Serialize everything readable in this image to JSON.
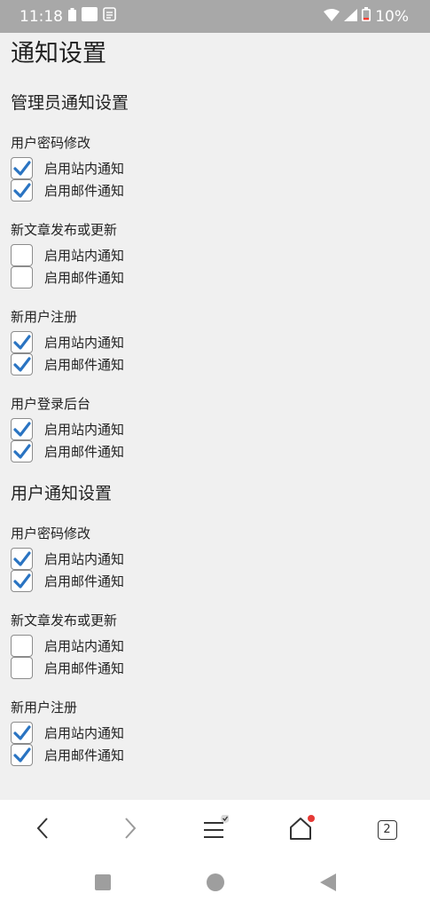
{
  "status_bar": {
    "time": "11:18",
    "battery": "10%"
  },
  "page_title": "通知设置",
  "sections": [
    {
      "title": "管理员通知设置",
      "groups": [
        {
          "label": "用户密码修改",
          "options": [
            {
              "label": "启用站内通知",
              "checked": true
            },
            {
              "label": "启用邮件通知",
              "checked": true
            }
          ]
        },
        {
          "label": "新文章发布或更新",
          "options": [
            {
              "label": "启用站内通知",
              "checked": false
            },
            {
              "label": "启用邮件通知",
              "checked": false
            }
          ]
        },
        {
          "label": "新用户注册",
          "options": [
            {
              "label": "启用站内通知",
              "checked": true
            },
            {
              "label": "启用邮件通知",
              "checked": true
            }
          ]
        },
        {
          "label": "用户登录后台",
          "options": [
            {
              "label": "启用站内通知",
              "checked": true
            },
            {
              "label": "启用邮件通知",
              "checked": true
            }
          ]
        }
      ]
    },
    {
      "title": "用户通知设置",
      "groups": [
        {
          "label": "用户密码修改",
          "options": [
            {
              "label": "启用站内通知",
              "checked": true
            },
            {
              "label": "启用邮件通知",
              "checked": true
            }
          ]
        },
        {
          "label": "新文章发布或更新",
          "options": [
            {
              "label": "启用站内通知",
              "checked": false
            },
            {
              "label": "启用邮件通知",
              "checked": false
            }
          ]
        },
        {
          "label": "新用户注册",
          "options": [
            {
              "label": "启用站内通知",
              "checked": true
            },
            {
              "label": "启用邮件通知",
              "checked": true
            }
          ]
        }
      ]
    }
  ],
  "browser_nav": {
    "tab_count": "2"
  },
  "colors": {
    "check": "#2a74c2",
    "status_bar": "#a8a8a8",
    "badge": "#e53935"
  },
  "icons": [
    "back-icon",
    "forward-icon",
    "menu-icon",
    "home-icon",
    "tabs-icon",
    "square-icon",
    "circle-icon",
    "triangle-back-icon"
  ]
}
